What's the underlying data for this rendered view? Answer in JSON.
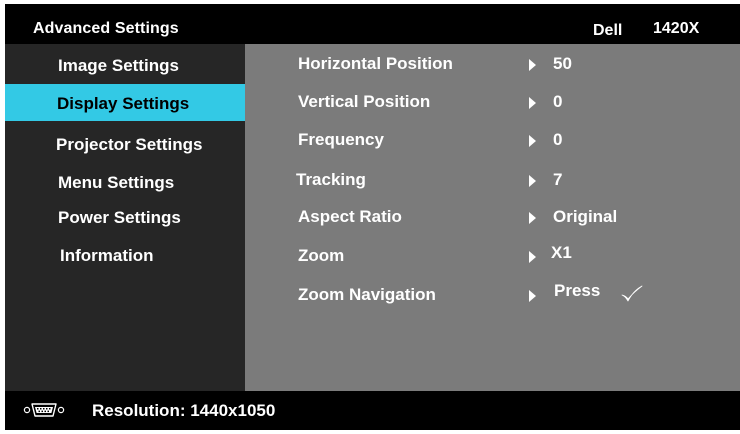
{
  "header": {
    "title": "Advanced Settings",
    "brand": "Dell",
    "model": "1420X"
  },
  "sidebar": {
    "items": [
      {
        "label": "Image Settings",
        "active": false
      },
      {
        "label": "Display Settings",
        "active": true
      },
      {
        "label": "Projector Settings",
        "active": false
      },
      {
        "label": "Menu Settings",
        "active": false
      },
      {
        "label": "Power Settings",
        "active": false
      },
      {
        "label": "Information",
        "active": false
      }
    ]
  },
  "settings": {
    "rows": [
      {
        "label": "Horizontal Position",
        "value": "50"
      },
      {
        "label": "Vertical Position",
        "value": "0"
      },
      {
        "label": "Frequency",
        "value": "0"
      },
      {
        "label": "Tracking",
        "value": "7"
      },
      {
        "label": "Aspect Ratio",
        "value": "Original"
      },
      {
        "label": "Zoom",
        "value": "X1"
      },
      {
        "label": "Zoom Navigation",
        "value": "Press"
      }
    ]
  },
  "footer": {
    "status": "Resolution: 1440x1050",
    "icon": "vga-connector-icon"
  },
  "colors": {
    "accent": "#33c9e5",
    "sidebar_bg": "#262626",
    "content_bg": "#7b7b7b",
    "frame_bg": "#000000"
  }
}
